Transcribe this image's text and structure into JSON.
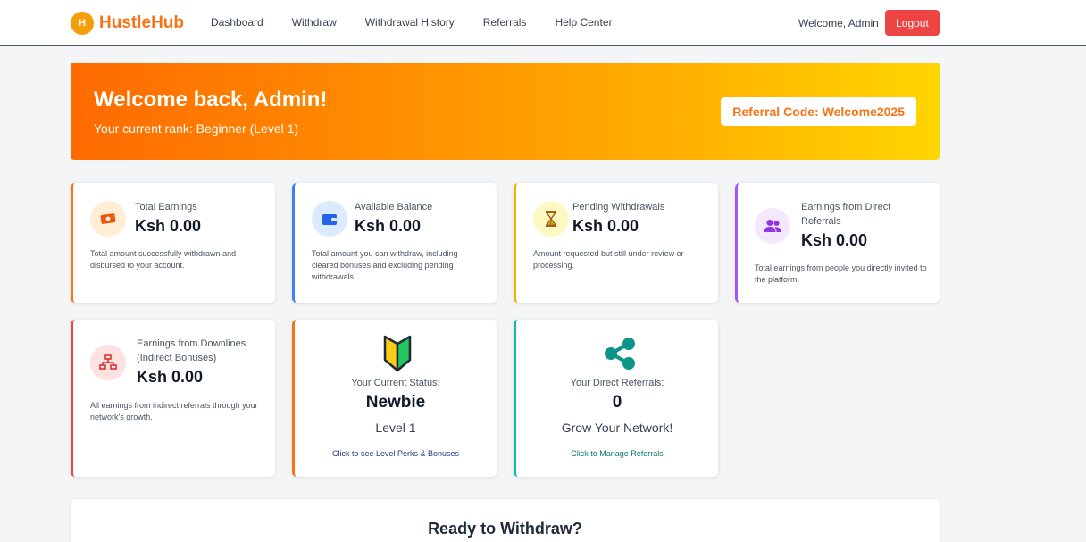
{
  "nav": {
    "brand_initial": "H",
    "brand_name": "HustleHub",
    "links": [
      "Dashboard",
      "Withdraw",
      "Withdrawal History",
      "Referrals",
      "Help Center"
    ],
    "welcome": "Welcome, Admin",
    "logout_label": "Logout"
  },
  "hero": {
    "title": "Welcome back, Admin!",
    "rank": "Your current rank: Beginner (Level 1)",
    "referral_code": "Referral Code: Welcome2025"
  },
  "stats": [
    {
      "label": "Total Earnings",
      "value": "Ksh 0.00",
      "desc": "Total amount successfully withdrawn and disbursed to your account.",
      "icon": "money-icon",
      "accent": "#f97316"
    },
    {
      "label": "Available Balance",
      "value": "Ksh 0.00",
      "desc": "Total amount you can withdraw, including cleared bonuses and excluding pending withdrawals.",
      "icon": "wallet-icon",
      "accent": "#3b82f6"
    },
    {
      "label": "Pending Withdrawals",
      "value": "Ksh 0.00",
      "desc": "Amount requested but still under review or processing.",
      "icon": "hourglass-icon",
      "accent": "#eab308"
    },
    {
      "label": "Earnings from Direct Referrals",
      "value": "Ksh 0.00",
      "desc": "Total earnings from people you directly invited to the platform.",
      "icon": "users-icon",
      "accent": "#a855f7"
    },
    {
      "label": "Earnings from Downlines (Indirect Bonuses)",
      "value": "Ksh 0.00",
      "desc": "All earnings from indirect referrals through your network's growth.",
      "icon": "network-icon",
      "accent": "#ef4444"
    }
  ],
  "status_card": {
    "label": "Your Current Status:",
    "value": "Newbie",
    "level": "Level 1",
    "link": "Click to see Level Perks & Bonuses",
    "accent": "#f97316"
  },
  "referrals_card": {
    "label": "Your Direct Referrals:",
    "value": "0",
    "tagline": "Grow Your Network!",
    "link": "Click to Manage Referrals",
    "accent": "#14b8a6"
  },
  "withdraw": {
    "title": "Ready to Withdraw?"
  }
}
